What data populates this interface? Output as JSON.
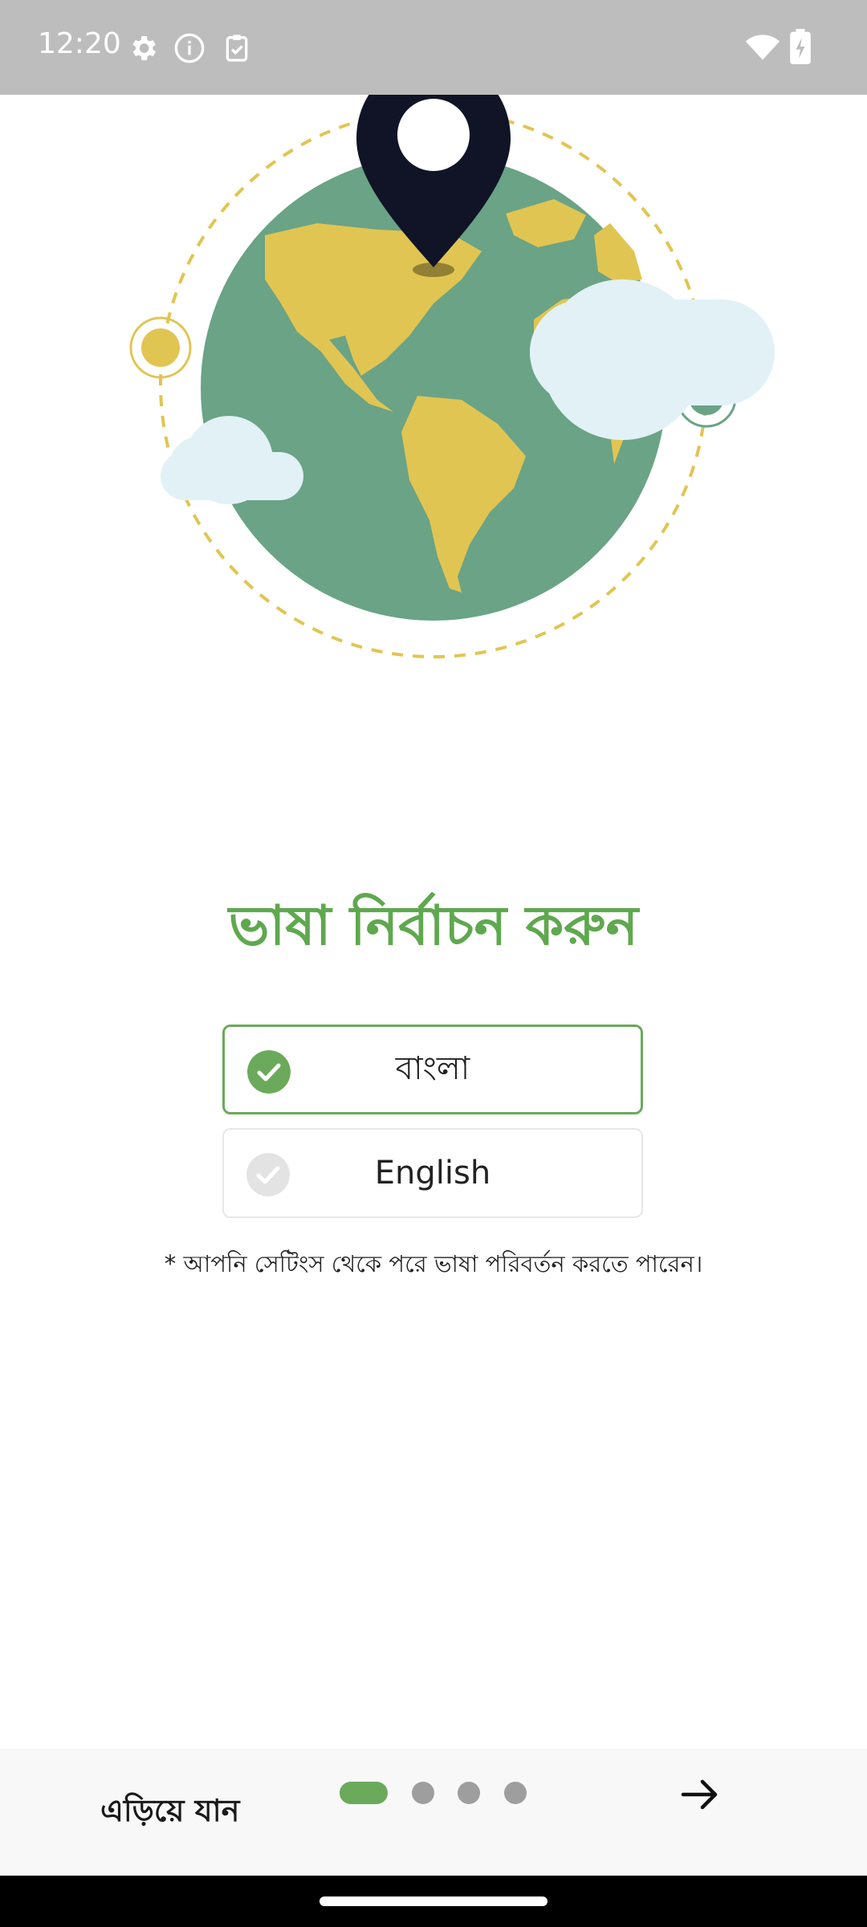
{
  "status_bar": {
    "time": "12:20",
    "left_icons": [
      "gear-icon",
      "info-icon",
      "clipboard-check-icon"
    ],
    "right_icons": [
      "wifi-icon",
      "battery-charging-icon"
    ]
  },
  "illustration": {
    "elements": [
      "globe",
      "location-pin",
      "clouds",
      "orbit-dots"
    ],
    "colors": {
      "ocean": "#6aa386",
      "land": "#e1c552",
      "pin": "#101426",
      "cloud": "#e2f1f6",
      "orbit": "#e1c552"
    }
  },
  "title": "ভাষা নির্বাচন করুন",
  "languages": [
    {
      "label": "বাংলা",
      "selected": true
    },
    {
      "label": "English",
      "selected": false
    }
  ],
  "note": "* আপনি সেটিংস থেকে পরে ভাষা পরিবর্তন করতে পারেন।",
  "bottom_bar": {
    "skip_label": "এড়িয়ে যান",
    "page_count": 4,
    "current_page": 1,
    "next_icon": "arrow-right-icon"
  },
  "colors": {
    "accent": "#6aaa5a",
    "title": "#5fa84f",
    "inactive_dot": "#9e9e9e",
    "status_bar": "#bdbdbd"
  }
}
